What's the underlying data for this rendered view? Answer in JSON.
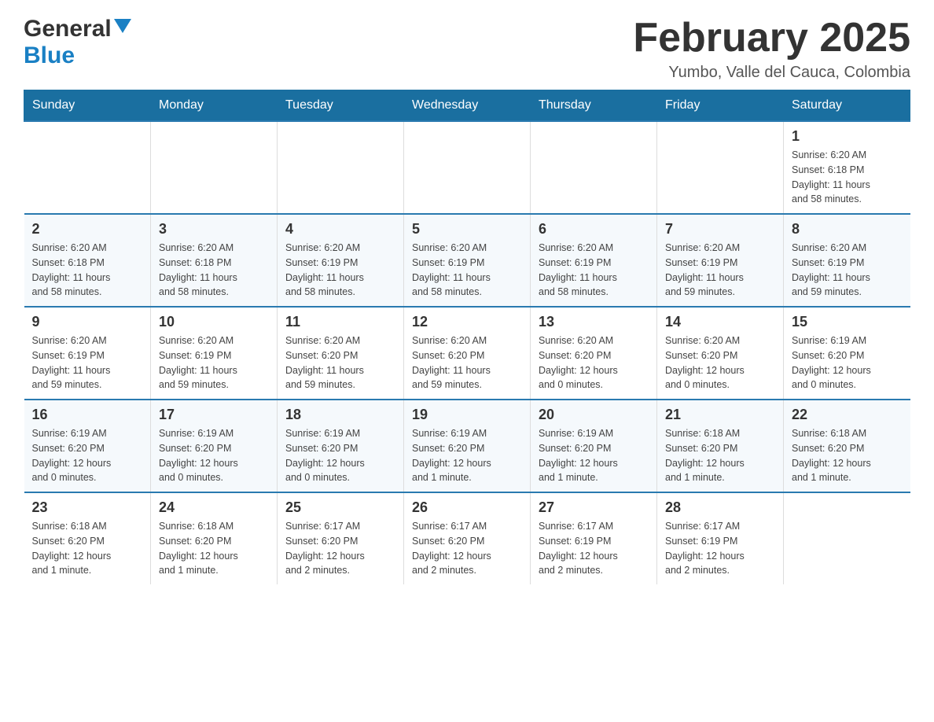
{
  "header": {
    "logo_general": "General",
    "logo_blue": "Blue",
    "month_title": "February 2025",
    "location": "Yumbo, Valle del Cauca, Colombia"
  },
  "weekdays": [
    "Sunday",
    "Monday",
    "Tuesday",
    "Wednesday",
    "Thursday",
    "Friday",
    "Saturday"
  ],
  "weeks": [
    {
      "days": [
        {
          "num": "",
          "info": ""
        },
        {
          "num": "",
          "info": ""
        },
        {
          "num": "",
          "info": ""
        },
        {
          "num": "",
          "info": ""
        },
        {
          "num": "",
          "info": ""
        },
        {
          "num": "",
          "info": ""
        },
        {
          "num": "1",
          "info": "Sunrise: 6:20 AM\nSunset: 6:18 PM\nDaylight: 11 hours\nand 58 minutes."
        }
      ]
    },
    {
      "days": [
        {
          "num": "2",
          "info": "Sunrise: 6:20 AM\nSunset: 6:18 PM\nDaylight: 11 hours\nand 58 minutes."
        },
        {
          "num": "3",
          "info": "Sunrise: 6:20 AM\nSunset: 6:18 PM\nDaylight: 11 hours\nand 58 minutes."
        },
        {
          "num": "4",
          "info": "Sunrise: 6:20 AM\nSunset: 6:19 PM\nDaylight: 11 hours\nand 58 minutes."
        },
        {
          "num": "5",
          "info": "Sunrise: 6:20 AM\nSunset: 6:19 PM\nDaylight: 11 hours\nand 58 minutes."
        },
        {
          "num": "6",
          "info": "Sunrise: 6:20 AM\nSunset: 6:19 PM\nDaylight: 11 hours\nand 58 minutes."
        },
        {
          "num": "7",
          "info": "Sunrise: 6:20 AM\nSunset: 6:19 PM\nDaylight: 11 hours\nand 59 minutes."
        },
        {
          "num": "8",
          "info": "Sunrise: 6:20 AM\nSunset: 6:19 PM\nDaylight: 11 hours\nand 59 minutes."
        }
      ]
    },
    {
      "days": [
        {
          "num": "9",
          "info": "Sunrise: 6:20 AM\nSunset: 6:19 PM\nDaylight: 11 hours\nand 59 minutes."
        },
        {
          "num": "10",
          "info": "Sunrise: 6:20 AM\nSunset: 6:19 PM\nDaylight: 11 hours\nand 59 minutes."
        },
        {
          "num": "11",
          "info": "Sunrise: 6:20 AM\nSunset: 6:20 PM\nDaylight: 11 hours\nand 59 minutes."
        },
        {
          "num": "12",
          "info": "Sunrise: 6:20 AM\nSunset: 6:20 PM\nDaylight: 11 hours\nand 59 minutes."
        },
        {
          "num": "13",
          "info": "Sunrise: 6:20 AM\nSunset: 6:20 PM\nDaylight: 12 hours\nand 0 minutes."
        },
        {
          "num": "14",
          "info": "Sunrise: 6:20 AM\nSunset: 6:20 PM\nDaylight: 12 hours\nand 0 minutes."
        },
        {
          "num": "15",
          "info": "Sunrise: 6:19 AM\nSunset: 6:20 PM\nDaylight: 12 hours\nand 0 minutes."
        }
      ]
    },
    {
      "days": [
        {
          "num": "16",
          "info": "Sunrise: 6:19 AM\nSunset: 6:20 PM\nDaylight: 12 hours\nand 0 minutes."
        },
        {
          "num": "17",
          "info": "Sunrise: 6:19 AM\nSunset: 6:20 PM\nDaylight: 12 hours\nand 0 minutes."
        },
        {
          "num": "18",
          "info": "Sunrise: 6:19 AM\nSunset: 6:20 PM\nDaylight: 12 hours\nand 0 minutes."
        },
        {
          "num": "19",
          "info": "Sunrise: 6:19 AM\nSunset: 6:20 PM\nDaylight: 12 hours\nand 1 minute."
        },
        {
          "num": "20",
          "info": "Sunrise: 6:19 AM\nSunset: 6:20 PM\nDaylight: 12 hours\nand 1 minute."
        },
        {
          "num": "21",
          "info": "Sunrise: 6:18 AM\nSunset: 6:20 PM\nDaylight: 12 hours\nand 1 minute."
        },
        {
          "num": "22",
          "info": "Sunrise: 6:18 AM\nSunset: 6:20 PM\nDaylight: 12 hours\nand 1 minute."
        }
      ]
    },
    {
      "days": [
        {
          "num": "23",
          "info": "Sunrise: 6:18 AM\nSunset: 6:20 PM\nDaylight: 12 hours\nand 1 minute."
        },
        {
          "num": "24",
          "info": "Sunrise: 6:18 AM\nSunset: 6:20 PM\nDaylight: 12 hours\nand 1 minute."
        },
        {
          "num": "25",
          "info": "Sunrise: 6:17 AM\nSunset: 6:20 PM\nDaylight: 12 hours\nand 2 minutes."
        },
        {
          "num": "26",
          "info": "Sunrise: 6:17 AM\nSunset: 6:20 PM\nDaylight: 12 hours\nand 2 minutes."
        },
        {
          "num": "27",
          "info": "Sunrise: 6:17 AM\nSunset: 6:19 PM\nDaylight: 12 hours\nand 2 minutes."
        },
        {
          "num": "28",
          "info": "Sunrise: 6:17 AM\nSunset: 6:19 PM\nDaylight: 12 hours\nand 2 minutes."
        },
        {
          "num": "",
          "info": ""
        }
      ]
    }
  ]
}
